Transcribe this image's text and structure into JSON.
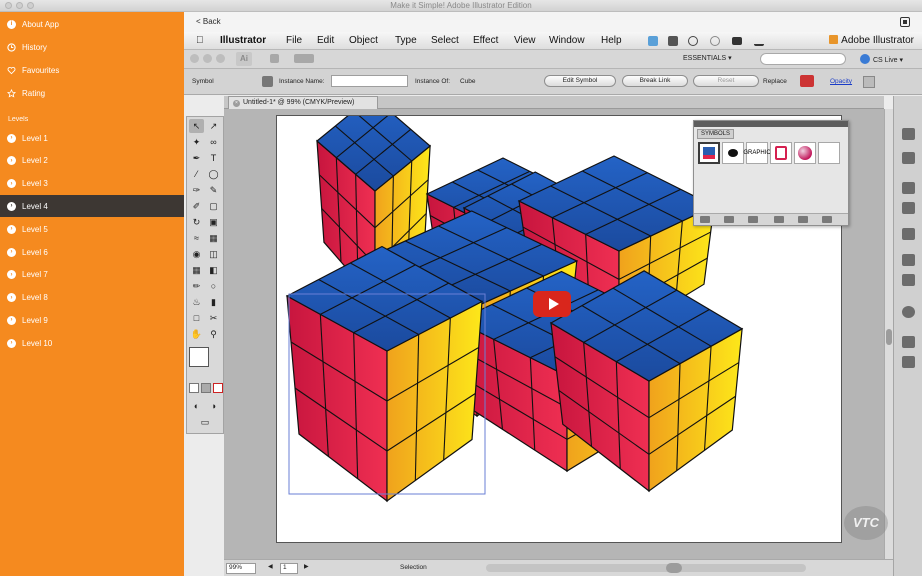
{
  "window": {
    "title": "Make it Simple! Adobe Illustrator Edition"
  },
  "sidebar": {
    "items_top": [
      {
        "label": "About App",
        "icon": "info-icon"
      },
      {
        "label": "History",
        "icon": "clock-icon"
      },
      {
        "label": "Favourites",
        "icon": "heart-icon"
      },
      {
        "label": "Rating",
        "icon": "star-icon"
      }
    ],
    "section_label": "Levels",
    "levels": [
      {
        "label": "Level 1",
        "active": false
      },
      {
        "label": "Level 2",
        "active": false
      },
      {
        "label": "Level 3",
        "active": false
      },
      {
        "label": "Level 4",
        "active": true
      },
      {
        "label": "Level 5",
        "active": false
      },
      {
        "label": "Level 6",
        "active": false
      },
      {
        "label": "Level 7",
        "active": false
      },
      {
        "label": "Level 8",
        "active": false
      },
      {
        "label": "Level 9",
        "active": false
      },
      {
        "label": "Level 10",
        "active": false
      }
    ]
  },
  "content": {
    "back_label": "< Back"
  },
  "illustrator": {
    "menus": [
      "Illustrator",
      "File",
      "Edit",
      "Object",
      "Type",
      "Select",
      "Effect",
      "View",
      "Window",
      "Help"
    ],
    "brand": "Adobe Illustrator",
    "appbar": {
      "logo": "Ai",
      "workspace": "ESSENTIALS ▾",
      "cs_live": "CS Live ▾"
    },
    "control": {
      "symbol_label": "Symbol",
      "instance_name_label": "Instance Name:",
      "instance_of_label": "Instance Of:",
      "instance_of_value": "Cube",
      "edit_symbol": "Edit Symbol",
      "break_link": "Break Link",
      "reset": "Reset",
      "replace_label": "Replace",
      "opacity_label": "Opacity"
    },
    "doc_tab": "Untitled-1* @ 99% (CMYK/Preview)",
    "status": {
      "zoom": "99%",
      "page": "1",
      "tool": "Selection"
    },
    "symbols_panel": {
      "title": "SYMBOLS",
      "cells": [
        "",
        "",
        "GRAPHIC",
        "",
        "",
        ""
      ]
    }
  },
  "video": {
    "watermark": "VTC"
  },
  "colors": {
    "sidebar": "#f58a1f",
    "active": "#3d3733",
    "cube_top": "#2a5db0",
    "cube_left": "#e0244a",
    "cube_right": "#f5c518",
    "play": "#d9261c"
  }
}
